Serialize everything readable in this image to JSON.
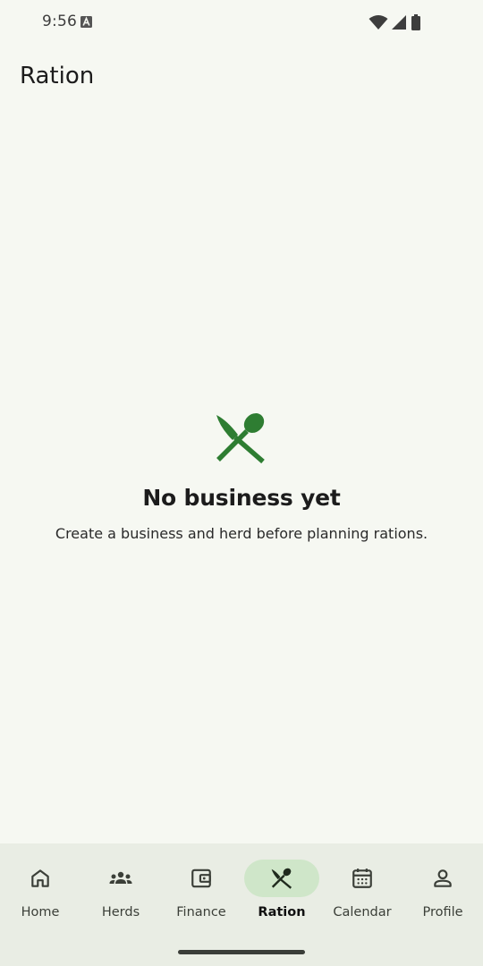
{
  "status_bar": {
    "time": "9:56"
  },
  "header": {
    "title": "Ration"
  },
  "empty_state": {
    "icon": "restaurant-icon",
    "title": "No business yet",
    "subtitle": "Create a business and herd before planning rations."
  },
  "nav": {
    "active": "Ration",
    "items": [
      {
        "label": "Home",
        "icon": "home-icon"
      },
      {
        "label": "Herds",
        "icon": "groups-icon"
      },
      {
        "label": "Finance",
        "icon": "wallet-icon"
      },
      {
        "label": "Ration",
        "icon": "restaurant-icon"
      },
      {
        "label": "Calendar",
        "icon": "calendar-icon"
      },
      {
        "label": "Profile",
        "icon": "person-icon"
      }
    ]
  },
  "colors": {
    "background": "#f6f8f2",
    "accent": "#2e7d32",
    "nav_background": "#e9ede4",
    "active_pill": "#cfe6c9"
  }
}
